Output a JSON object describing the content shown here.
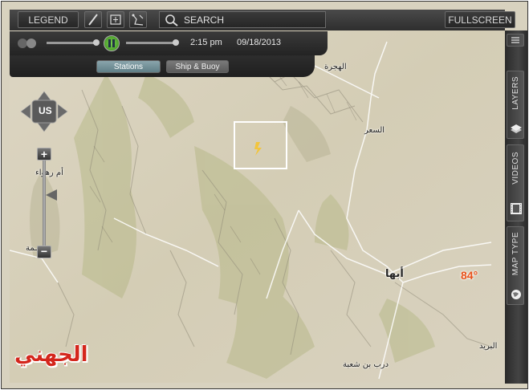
{
  "toolbar": {
    "legend_label": "LEGEND",
    "search_label": "SEARCH",
    "fullscreen_label": "FULLSCREEN",
    "tools": [
      "draw-icon",
      "measure-icon",
      "route-icon"
    ]
  },
  "playback": {
    "time": "2:15 pm",
    "date": "09/18/2013"
  },
  "tabs": {
    "stations_label": "Stations",
    "ship_buoy_label": "Ship & Buoy"
  },
  "side_panel": {
    "layers_label": "LAYERS",
    "videos_label": "VIDEOS",
    "map_type_label": "MAP TYPE"
  },
  "navigation": {
    "region_label": "US"
  },
  "map": {
    "labels": {
      "hajra": "الهجرة",
      "alsaeer": "السعر",
      "abha": "أبها",
      "umm_rahwa": "أم رهواء",
      "tama": "ـمة",
      "albirk": "البريد",
      "darb": "درب بن شعبة"
    },
    "temperature": "84°",
    "watermark": "الجهني"
  },
  "colors": {
    "toolbar_bg": "#2e2e2e",
    "active_tab": "#6f8f97",
    "temperature": "#e8511a",
    "watermark": "#d4261c"
  }
}
